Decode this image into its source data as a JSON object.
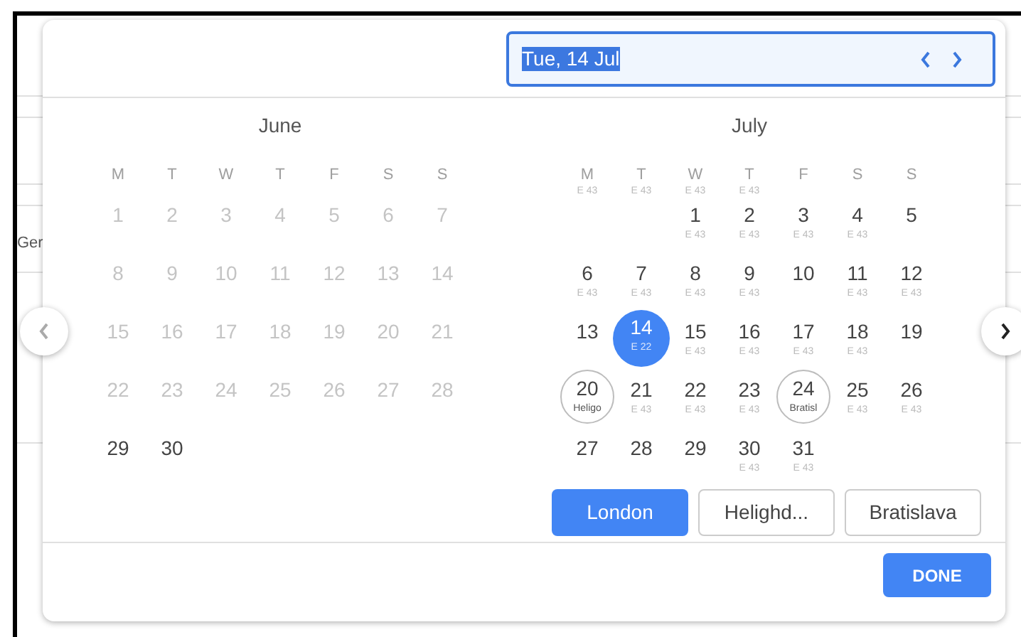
{
  "background": {
    "text": "Ger"
  },
  "date_field": {
    "value": "Tue, 14 Jul",
    "text_selected": true
  },
  "months": [
    {
      "title": "June",
      "weekdays": [
        {
          "label": "M"
        },
        {
          "label": "T"
        },
        {
          "label": "W"
        },
        {
          "label": "T"
        },
        {
          "label": "F"
        },
        {
          "label": "S"
        },
        {
          "label": "S"
        }
      ],
      "weeks": [
        [
          {
            "day": "1",
            "disabled": true
          },
          {
            "day": "2",
            "disabled": true
          },
          {
            "day": "3",
            "disabled": true
          },
          {
            "day": "4",
            "disabled": true
          },
          {
            "day": "5",
            "disabled": true
          },
          {
            "day": "6",
            "disabled": true
          },
          {
            "day": "7",
            "disabled": true
          }
        ],
        [
          {
            "day": "8",
            "disabled": true
          },
          {
            "day": "9",
            "disabled": true
          },
          {
            "day": "10",
            "disabled": true
          },
          {
            "day": "11",
            "disabled": true
          },
          {
            "day": "12",
            "disabled": true
          },
          {
            "day": "13",
            "disabled": true
          },
          {
            "day": "14",
            "disabled": true
          }
        ],
        [
          {
            "day": "15",
            "disabled": true
          },
          {
            "day": "16",
            "disabled": true
          },
          {
            "day": "17",
            "disabled": true
          },
          {
            "day": "18",
            "disabled": true
          },
          {
            "day": "19",
            "disabled": true
          },
          {
            "day": "20",
            "disabled": true
          },
          {
            "day": "21",
            "disabled": true
          }
        ],
        [
          {
            "day": "22",
            "disabled": true
          },
          {
            "day": "23",
            "disabled": true
          },
          {
            "day": "24",
            "disabled": true
          },
          {
            "day": "25",
            "disabled": true
          },
          {
            "day": "26",
            "disabled": true
          },
          {
            "day": "27",
            "disabled": true
          },
          {
            "day": "28",
            "disabled": true
          }
        ],
        [
          {
            "day": "29",
            "disabled": false
          },
          {
            "day": "30",
            "disabled": false
          }
        ]
      ]
    },
    {
      "title": "July",
      "weekdays": [
        {
          "label": "M",
          "note": "E 43"
        },
        {
          "label": "T",
          "note": "E 43"
        },
        {
          "label": "W",
          "note": "E 43"
        },
        {
          "label": "T",
          "note": "E 43"
        },
        {
          "label": "F"
        },
        {
          "label": "S"
        },
        {
          "label": "S"
        }
      ],
      "weeks": [
        [
          {
            "day": "1",
            "note": "E 43",
            "disabled": false,
            "selected": false,
            "circled": false
          },
          {
            "day": "2",
            "note": "E 43",
            "disabled": false,
            "selected": false,
            "circled": false
          },
          {
            "day": "3",
            "note": "E 43",
            "disabled": false,
            "selected": false,
            "circled": false
          },
          {
            "day": "4",
            "note": "E 43",
            "disabled": false,
            "selected": false,
            "circled": false
          },
          {
            "day": "5",
            "disabled": false,
            "selected": false,
            "circled": false
          }
        ],
        [
          {
            "day": "6",
            "note": "E 43",
            "disabled": false,
            "selected": false,
            "circled": false
          },
          {
            "day": "7",
            "note": "E 43",
            "disabled": false,
            "selected": false,
            "circled": false
          },
          {
            "day": "8",
            "note": "E 43",
            "disabled": false,
            "selected": false,
            "circled": false
          },
          {
            "day": "9",
            "note": "E 43",
            "disabled": false,
            "selected": false,
            "circled": false
          },
          {
            "day": "10",
            "disabled": false,
            "selected": false,
            "circled": false
          },
          {
            "day": "11",
            "note": "E 43",
            "disabled": false,
            "selected": false,
            "circled": false
          },
          {
            "day": "12",
            "note": "E 43",
            "disabled": false,
            "selected": false,
            "circled": false
          }
        ],
        [
          {
            "day": "13",
            "disabled": false,
            "selected": false,
            "circled": false
          },
          {
            "day": "14",
            "note": "E 22",
            "disabled": false,
            "selected": true,
            "circled": false
          },
          {
            "day": "15",
            "note": "E 43",
            "disabled": false,
            "selected": false,
            "circled": false
          },
          {
            "day": "16",
            "note": "E 43",
            "disabled": false,
            "selected": false,
            "circled": false
          },
          {
            "day": "17",
            "note": "E 43",
            "disabled": false,
            "selected": false,
            "circled": false
          },
          {
            "day": "18",
            "note": "E 43",
            "disabled": false,
            "selected": false,
            "circled": false
          },
          {
            "day": "19",
            "disabled": false,
            "selected": false,
            "circled": false
          }
        ],
        [
          {
            "day": "20",
            "note": "Heligo",
            "disabled": false,
            "selected": false,
            "circled": true
          },
          {
            "day": "21",
            "note": "E 43",
            "disabled": false,
            "selected": false,
            "circled": false
          },
          {
            "day": "22",
            "note": "E 43",
            "disabled": false,
            "selected": false,
            "circled": false
          },
          {
            "day": "23",
            "note": "E 43",
            "disabled": false,
            "selected": false,
            "circled": false
          },
          {
            "day": "24",
            "note": "Bratisl",
            "disabled": false,
            "selected": false,
            "circled": true
          },
          {
            "day": "25",
            "note": "E 43",
            "disabled": false,
            "selected": false,
            "circled": false
          },
          {
            "day": "26",
            "note": "E 43",
            "disabled": false,
            "selected": false,
            "circled": false
          }
        ],
        [
          {
            "day": "27",
            "disabled": false,
            "selected": false,
            "circled": false
          },
          {
            "day": "28",
            "disabled": false,
            "selected": false,
            "circled": false
          },
          {
            "day": "29",
            "disabled": false,
            "selected": false,
            "circled": false
          },
          {
            "day": "30",
            "note": "E 43",
            "disabled": false,
            "selected": false,
            "circled": false
          },
          {
            "day": "31",
            "note": "E 43",
            "disabled": false,
            "selected": false,
            "circled": false
          }
        ]
      ]
    }
  ],
  "locations": [
    {
      "label": "London",
      "selected": true
    },
    {
      "label": "Helighd...",
      "selected": false
    },
    {
      "label": "Bratislava",
      "selected": false
    }
  ],
  "done_button": "DONE"
}
